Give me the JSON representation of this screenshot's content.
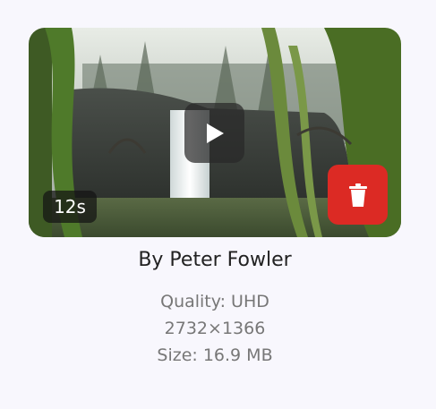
{
  "media": {
    "duration_label": "12s",
    "author": "By Peter Fowler",
    "quality": "Quality: UHD",
    "resolution": "2732×1366",
    "size": "Size: 16.9 MB"
  },
  "icons": {
    "play": "play-icon",
    "delete": "trash-icon"
  },
  "colors": {
    "delete_bg": "#dc2a24",
    "page_bg": "#f8f7fd"
  }
}
